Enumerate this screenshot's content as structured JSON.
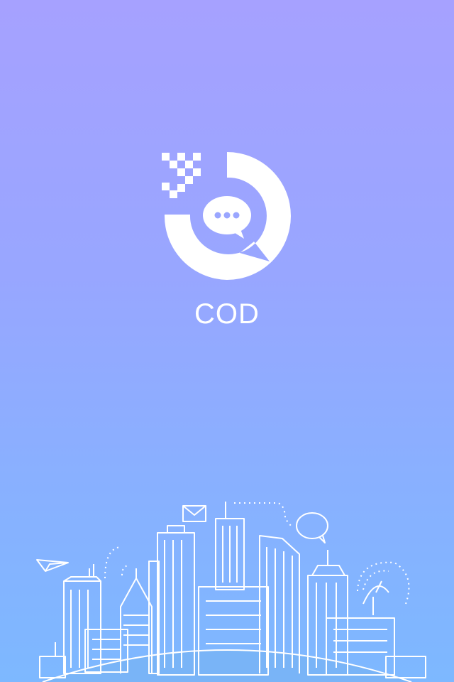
{
  "app": {
    "name": "COD"
  },
  "colors": {
    "gradient_top": "#a6a1ff",
    "gradient_bottom": "#7db8ff",
    "foreground": "#ffffff"
  },
  "illustration": {
    "icons": [
      "envelope-icon",
      "paper-plane-icon",
      "speech-bubble-icon",
      "satellite-dish-icon"
    ]
  }
}
